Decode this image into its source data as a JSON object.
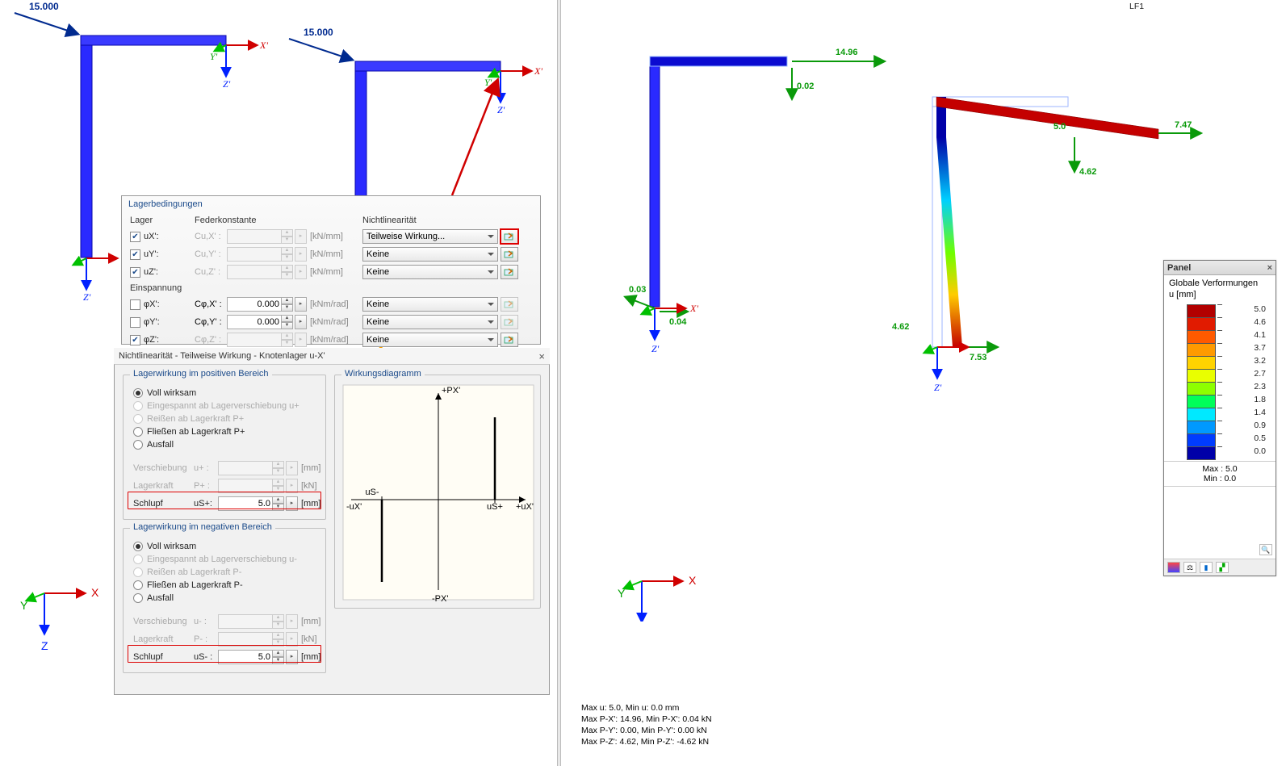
{
  "load_value_left": "15.000",
  "load_value_right": "15.000",
  "axes": {
    "x": "X'",
    "y": "Y'",
    "z": "Z'",
    "x_plain": "X",
    "z_plain": "Z"
  },
  "right_header": "LF1",
  "lager_dialog": {
    "title": "Lagerbedingungen",
    "col_lager": "Lager",
    "col_feder": "Federkonstante",
    "col_nl": "Nichtlinearität",
    "einspannung": "Einspannung",
    "rows_u": [
      {
        "chk": true,
        "lbl": "uX'",
        "spring": "Cu,X' :",
        "val": "",
        "unit": "[kN/mm]",
        "nl": "Teilweise Wirkung...",
        "hl": true
      },
      {
        "chk": true,
        "lbl": "uY'",
        "spring": "Cu,Y' :",
        "val": "",
        "unit": "[kN/mm]",
        "nl": "Keine"
      },
      {
        "chk": true,
        "lbl": "uZ'",
        "spring": "Cu,Z' :",
        "val": "",
        "unit": "[kN/mm]",
        "nl": "Keine"
      }
    ],
    "rows_phi": [
      {
        "chk": false,
        "lbl": "φX'",
        "spring": "Cφ,X' :",
        "val": "0.000",
        "unit": "[kNm/rad]",
        "nl": "Keine"
      },
      {
        "chk": false,
        "lbl": "φY'",
        "spring": "Cφ,Y' :",
        "val": "0.000",
        "unit": "[kNm/rad]",
        "nl": "Keine"
      },
      {
        "chk": true,
        "lbl": "φZ'",
        "spring": "Cφ,Z' :",
        "val": "",
        "unit": "[kNm/rad]",
        "nl": "Keine"
      }
    ]
  },
  "nl_dialog": {
    "title": "Nichtlinearität - Teilweise Wirkung - Knotenlager u-X'",
    "group_pos": "Lagerwirkung im positiven Bereich",
    "group_neg": "Lagerwirkung im negativen Bereich",
    "group_diag": "Wirkungsdiagramm",
    "r_voll": "Voll wirksam",
    "r_eing_p": "Eingespannt ab Lagerverschiebung u+",
    "r_reis_p": "Reißen ab Lagerkraft P+",
    "r_flie_p": "Fließen ab Lagerkraft P+",
    "r_ausfall": "Ausfall",
    "r_eing_n": "Eingespannt ab Lagerverschiebung u-",
    "r_reis_n": "Reißen ab Lagerkraft P-",
    "r_flie_n": "Fließen ab Lagerkraft P-",
    "p_versch": "Verschiebung",
    "p_lager": "Lagerkraft",
    "p_schlupf": "Schlupf",
    "sym_up": "u+  :",
    "sym_pp": "P+ :",
    "sym_usp": "uS+:",
    "sym_um": "u-  :",
    "sym_pm": "P-  :",
    "sym_usm": "uS- :",
    "u_mm": "[mm]",
    "u_kn": "[kN]",
    "val_slip": "5.0",
    "diag": {
      "px_p": "+PX'",
      "px_n": "-PX'",
      "us_p": "uS+",
      "us_n": "uS-",
      "ux_p": "+uX'",
      "ux_n": "-uX'"
    }
  },
  "results": {
    "vals": {
      "a": "14.96",
      "b": "0.02",
      "c": "0.03",
      "d": "0.04",
      "e": "7.47",
      "f": "4.62",
      "g": "4.62",
      "h": "7.53",
      "i": "5.0"
    },
    "stats": [
      "Max u: 5.0, Min u: 0.0 mm",
      "Max P-X': 14.96, Min P-X': 0.04 kN",
      "Max P-Y': 0.00, Min P-Y': 0.00 kN",
      "Max P-Z': 4.62, Min P-Z': -4.62 kN"
    ]
  },
  "panel": {
    "title": "Panel",
    "heading": "Globale Verformungen",
    "unit": "u [mm]",
    "scale": [
      {
        "v": "5.0",
        "c": "#b20000"
      },
      {
        "v": "4.6",
        "c": "#e11b00"
      },
      {
        "v": "4.1",
        "c": "#ff5a00"
      },
      {
        "v": "3.7",
        "c": "#ff9a00"
      },
      {
        "v": "3.2",
        "c": "#ffd300"
      },
      {
        "v": "2.7",
        "c": "#e9ff00"
      },
      {
        "v": "2.3",
        "c": "#8dff00"
      },
      {
        "v": "1.8",
        "c": "#00ff5a"
      },
      {
        "v": "1.4",
        "c": "#00e9ff"
      },
      {
        "v": "0.9",
        "c": "#0099ff"
      },
      {
        "v": "0.5",
        "c": "#003cff"
      },
      {
        "v": "0.0",
        "c": "#0000a8"
      }
    ],
    "max": "Max  :  5.0",
    "min": "Min  :  0.0"
  }
}
